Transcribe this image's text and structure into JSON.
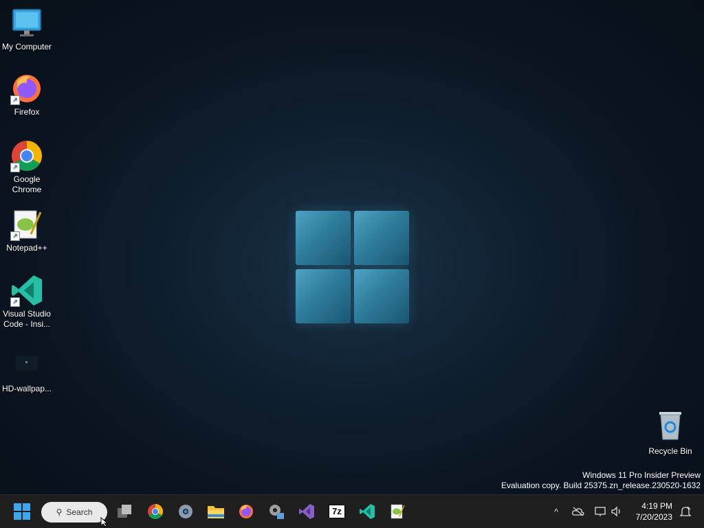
{
  "desktop": {
    "icons": [
      {
        "label": "My Computer",
        "icon": "monitor-icon"
      },
      {
        "label": "Firefox",
        "icon": "firefox-icon"
      },
      {
        "label_line1": "Google",
        "label_line2": "Chrome",
        "icon": "chrome-icon"
      },
      {
        "label": "Notepad++",
        "icon": "notepadpp-icon"
      },
      {
        "label_line1": "Visual Studio",
        "label_line2": "Code - Insi...",
        "icon": "vscode-icon"
      },
      {
        "label": "HD-wallpap...",
        "icon": "image-file-icon"
      }
    ],
    "recycle_bin": {
      "label": "Recycle Bin",
      "icon": "recycle-bin-icon"
    }
  },
  "watermark": {
    "line1": "Windows 11 Pro Insider Preview",
    "line2": "Evaluation copy. Build 25375.zn_release.230520-1632"
  },
  "taskbar": {
    "search_label": "Search",
    "apps": [
      "start-icon",
      "task-view-icon",
      "chrome-icon",
      "settings-icon",
      "file-explorer-icon",
      "firefox-icon",
      "gear-settings-icon",
      "visual-studio-icon",
      "7zip-icon",
      "vscode-icon",
      "notepadpp-icon"
    ],
    "sevenzip_label": "7z",
    "tray": {
      "chevron": "^",
      "icons": [
        "onedrive-offline-icon",
        "network-icon",
        "volume-icon",
        "notification-icon"
      ]
    },
    "clock": {
      "time": "4:19 PM",
      "date": "7/20/2023"
    }
  },
  "colors": {
    "taskbar": "#1f1f1f",
    "accent": "#0078d4",
    "logo": "#3a8fb0"
  }
}
